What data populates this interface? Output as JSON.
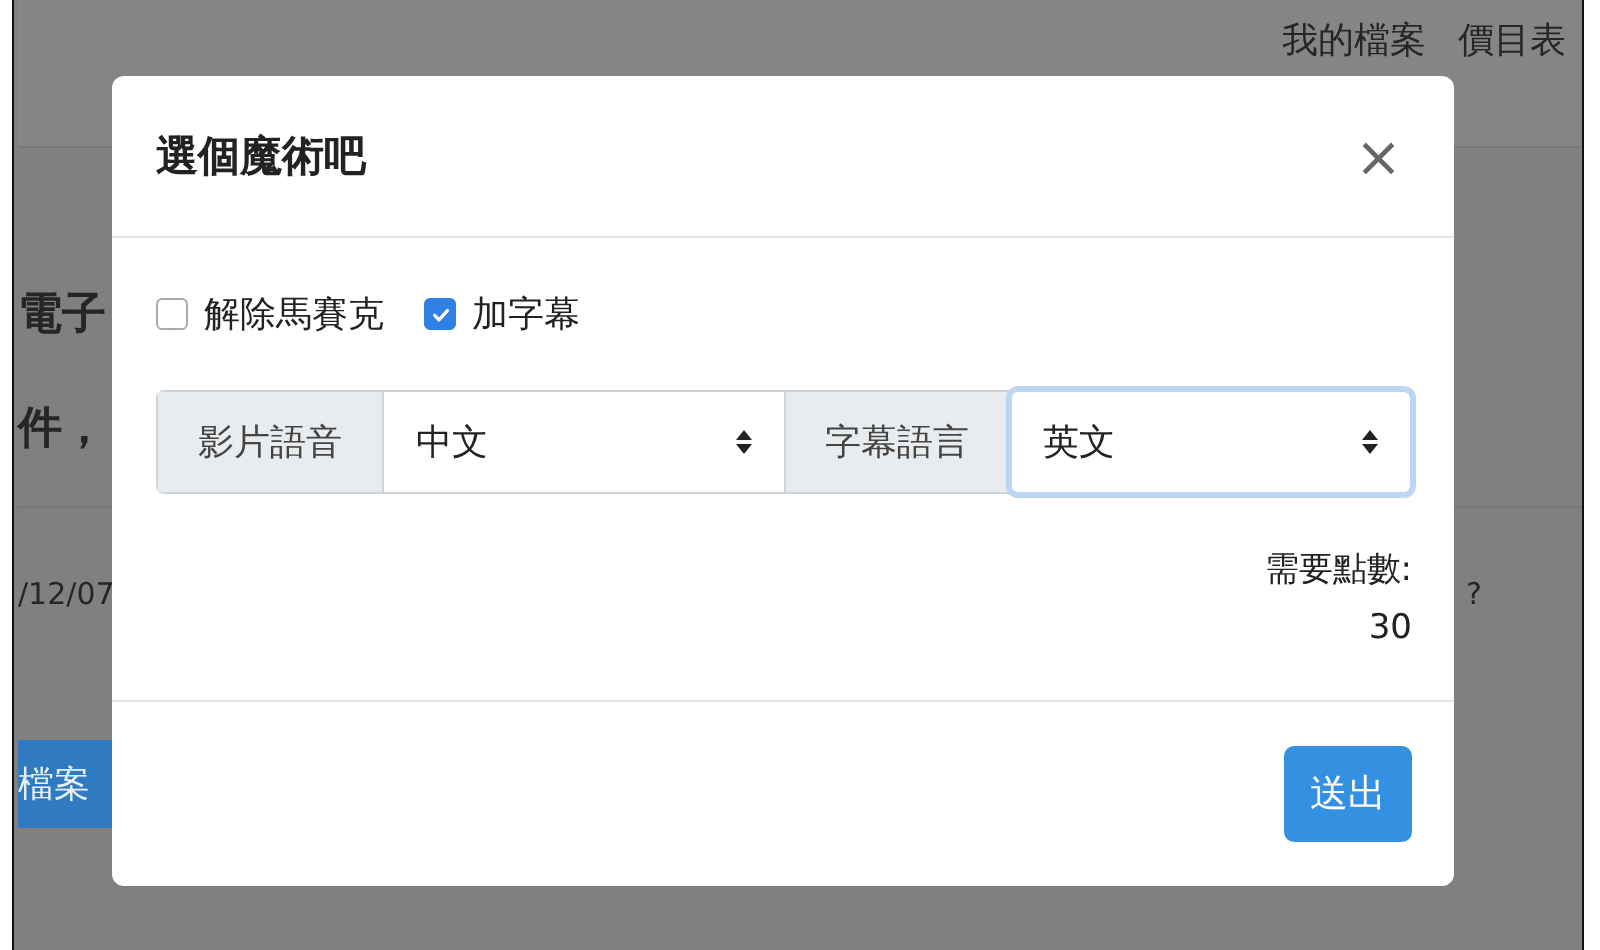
{
  "background": {
    "nav": [
      "我的檔案",
      "價目表"
    ],
    "heading_lines": [
      "電子",
      "件，"
    ],
    "date": "/12/07",
    "question_mark": "?",
    "button": "檔案"
  },
  "modal": {
    "title": "選個魔術吧",
    "close": "×",
    "options": [
      {
        "label": "解除馬賽克",
        "checked": false
      },
      {
        "label": "加字幕",
        "checked": true
      }
    ],
    "selects": [
      {
        "label": "影片語音",
        "value": "中文",
        "focused": false
      },
      {
        "label": "字幕語言",
        "value": "英文",
        "focused": true
      }
    ],
    "points_label": "需要點數:",
    "points": "30",
    "submit": "送出"
  }
}
